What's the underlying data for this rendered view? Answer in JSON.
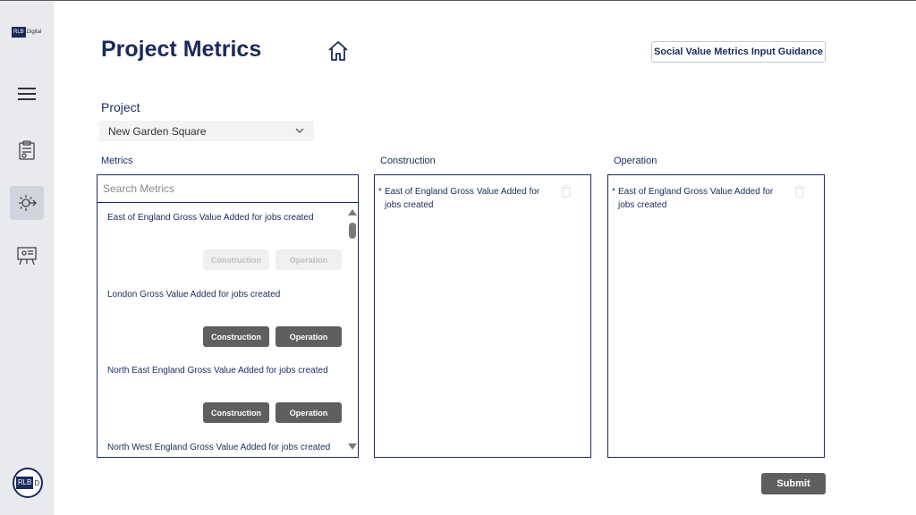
{
  "sidebar": {
    "logo": {
      "box": "RLB",
      "text": "Digital"
    },
    "avatar": {
      "box": "RLB",
      "text": "D"
    }
  },
  "header": {
    "title": "Project Metrics",
    "guidance_label": "Social Value Metrics Input Guidance"
  },
  "project": {
    "label": "Project",
    "selected": "New Garden Square"
  },
  "metrics": {
    "label": "Metrics",
    "search_placeholder": "Search Metrics",
    "items": [
      {
        "name": "East of England Gross Value Added for jobs created",
        "construction": "Construction",
        "operation": "Operation",
        "enabled": false
      },
      {
        "name": "London Gross Value Added for jobs created",
        "construction": "Construction",
        "operation": "Operation",
        "enabled": true
      },
      {
        "name": "North East England Gross Value Added for jobs created",
        "construction": "Construction",
        "operation": "Operation",
        "enabled": true
      },
      {
        "name": "North West England Gross Value Added for jobs created"
      }
    ]
  },
  "construction": {
    "label": "Construction",
    "entries": [
      {
        "star": "*",
        "text": "East of England Gross Value Added for jobs created"
      }
    ]
  },
  "operation": {
    "label": "Operation",
    "entries": [
      {
        "star": "*",
        "text": "East of England Gross Value Added for jobs created"
      }
    ]
  },
  "actions": {
    "submit_label": "Submit"
  },
  "colors": {
    "navy": "#1b2a5c",
    "button_dark": "#5f5f5f",
    "sidebar_bg": "#e8eaee"
  }
}
